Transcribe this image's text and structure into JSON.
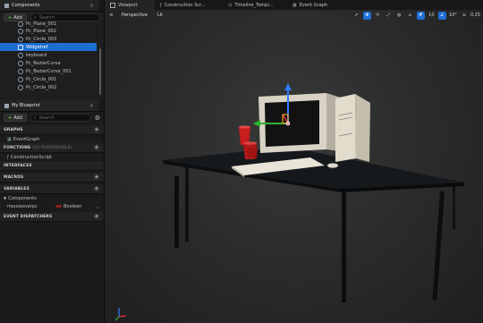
{
  "components_panel": {
    "tab_label": "Components",
    "add_label": "Add",
    "search_placeholder": "Search",
    "items": [
      {
        "label": "Pc_Plane_001"
      },
      {
        "label": "Pc_Plane_002"
      },
      {
        "label": "Pc_Circle_003"
      },
      {
        "label": "Widgetref"
      },
      {
        "label": "keyboard"
      },
      {
        "label": "Pc_BezierCurve"
      },
      {
        "label": "Pc_BezierCurve_001"
      },
      {
        "label": "Pc_Circle_001"
      },
      {
        "label": "Pc_Circle_002"
      }
    ]
  },
  "blueprint_panel": {
    "tab_label": "My Blueprint",
    "add_label": "Add",
    "search_placeholder": "Search",
    "graphs_label": "GRAPHS",
    "graph_item": "EventGraph",
    "functions_label": "FUNCTIONS",
    "functions_note": "(24 OVERRIDABLE)",
    "function_item": "ConstructionScript",
    "interfaces_label": "INTERFACES",
    "macros_label": "MACROS",
    "variables_label": "VARIABLES",
    "components_label": "Components",
    "variable_name": "mouseoverpc",
    "variable_type": "Boolean",
    "dispatchers_label": "EVENT DISPATCHERS"
  },
  "editor_tabs": [
    {
      "label": "Viewport"
    },
    {
      "label": "Construction Scr..."
    },
    {
      "label": "Timeline_Templ..."
    },
    {
      "label": "Event Graph"
    }
  ],
  "viewport": {
    "perspective_label": "Perspective",
    "lit_label": "Lit",
    "snap_value": "10",
    "angle_value": "10°",
    "scale_value": "0.25"
  },
  "colors": {
    "accent": "#1f6fd6",
    "selection": "#1c6fd1",
    "add_plus": "#69c24a",
    "boolean_pin": "#8b1d1d"
  },
  "icons": {
    "hamburger": "menu-icon",
    "settings": "gear-icon",
    "close": "close-icon"
  }
}
